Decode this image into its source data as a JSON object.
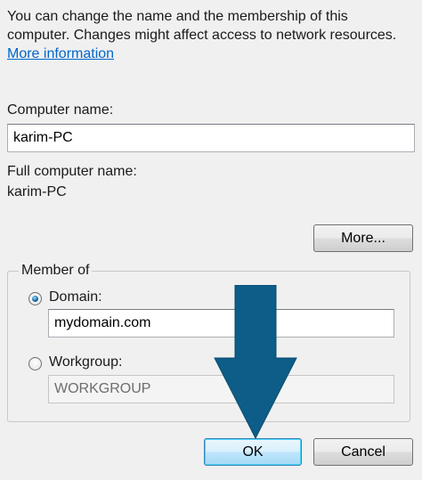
{
  "description": {
    "line1": "You can change the name and the membership of this",
    "line2": "computer. Changes might affect access to network resources.",
    "link": "More information"
  },
  "computer_name": {
    "label": "Computer name:",
    "value": "karim-PC"
  },
  "full_computer_name": {
    "label": "Full computer name:",
    "value": "karim-PC"
  },
  "more_button": "More...",
  "member_of": {
    "legend": "Member of",
    "domain": {
      "label": "Domain:",
      "selected": true,
      "value": "mydomain.com"
    },
    "workgroup": {
      "label": "Workgroup:",
      "selected": false,
      "value": "WORKGROUP"
    }
  },
  "buttons": {
    "ok": "OK",
    "cancel": "Cancel"
  },
  "colors": {
    "link": "#0066cc",
    "annotation_arrow": "#0d5d88"
  },
  "icons": [
    "down-arrow-icon"
  ]
}
